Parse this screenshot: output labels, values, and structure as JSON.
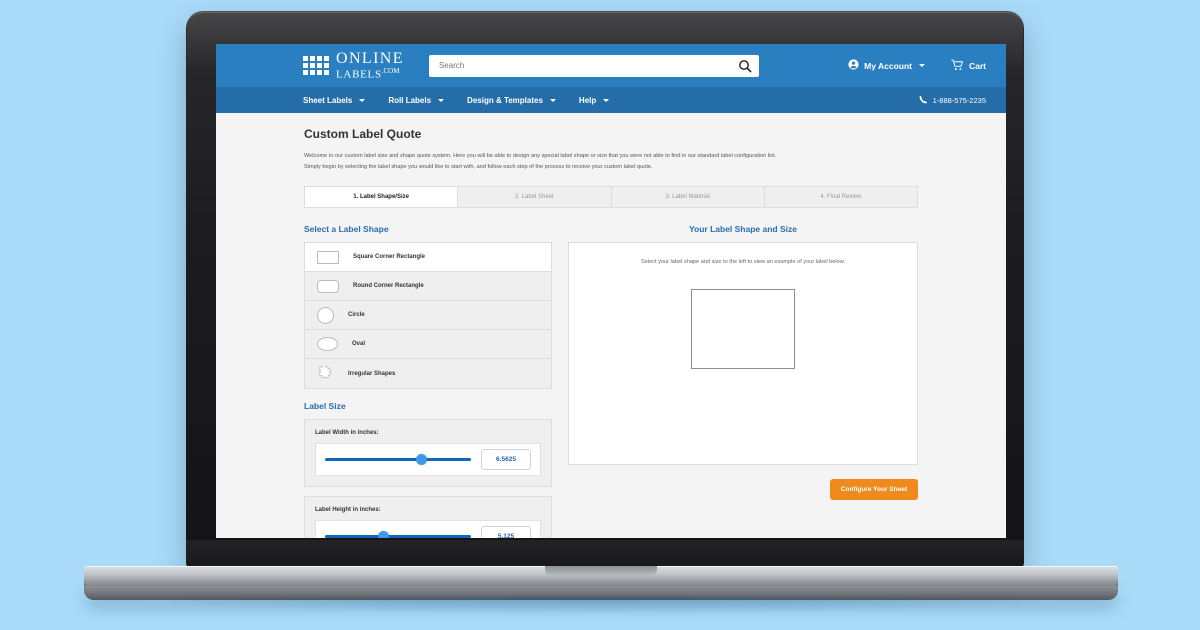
{
  "theme": {
    "page_background": "#a9dbf9",
    "header_blue": "#2a7fc0",
    "nav_blue": "#246da8",
    "accent_blue": "#2a6cb0",
    "slider_blue": "#1266bd",
    "knob_blue": "#3d9ae8",
    "cta_orange": "#f08a1c"
  },
  "header": {
    "logo": {
      "line1": "ONLINE",
      "line2": "LABELS",
      "suffix": ".COM",
      "icon": "grid-icon"
    },
    "search": {
      "placeholder": "Search",
      "value": "",
      "icon": "search-icon"
    },
    "account": {
      "label": "My Account",
      "icon": "user-icon",
      "chevron": "chevron-down-icon"
    },
    "cart": {
      "label": "Cart",
      "icon": "cart-icon"
    }
  },
  "nav": {
    "items": [
      {
        "label": "Sheet Labels",
        "chevron": "chevron-down-icon"
      },
      {
        "label": "Roll Labels",
        "chevron": "chevron-down-icon"
      },
      {
        "label": "Design & Templates",
        "chevron": "chevron-down-icon"
      },
      {
        "label": "Help",
        "chevron": "chevron-down-icon"
      }
    ],
    "phone": {
      "number": "1-888-575-2235",
      "icon": "phone-icon"
    }
  },
  "page": {
    "title": "Custom Label Quote",
    "description_line1": "Welcome to our custom label size and shape quote system. Here you will be able to design any special label shape or size that you were not able to find in our standard label configuration list.",
    "description_line2": "Simply begin by selecting the label shape you would like to start with, and follow each step of the process to receive your custom label quote."
  },
  "steps": [
    {
      "label": "1. Label Shape/Size",
      "active": true
    },
    {
      "label": "2. Label Sheet",
      "active": false
    },
    {
      "label": "3. Label Material",
      "active": false
    },
    {
      "label": "4. Final Review",
      "active": false
    }
  ],
  "shape_section": {
    "title": "Select a Label Shape",
    "options": [
      {
        "label": "Square Corner Rectangle",
        "icon": "square-corner-rectangle-icon",
        "selected": true
      },
      {
        "label": "Round Corner Rectangle",
        "icon": "round-corner-rectangle-icon",
        "selected": false
      },
      {
        "label": "Circle",
        "icon": "circle-icon",
        "selected": false
      },
      {
        "label": "Oval",
        "icon": "oval-icon",
        "selected": false
      },
      {
        "label": "Irregular Shapes",
        "icon": "irregular-shape-icon",
        "selected": false
      }
    ]
  },
  "size_section": {
    "title": "Label Size",
    "width": {
      "label": "Label Width in inches:",
      "value": "6.5625",
      "slider_percent": 66
    },
    "height": {
      "label": "Label Height in inches:",
      "value": "5.125",
      "slider_percent": 41
    }
  },
  "preview": {
    "title": "Your Label Shape and Size",
    "hint": "Select your label shape and size to the left to view an example of your label below."
  },
  "cta": {
    "label": "Configure Your Sheet"
  }
}
